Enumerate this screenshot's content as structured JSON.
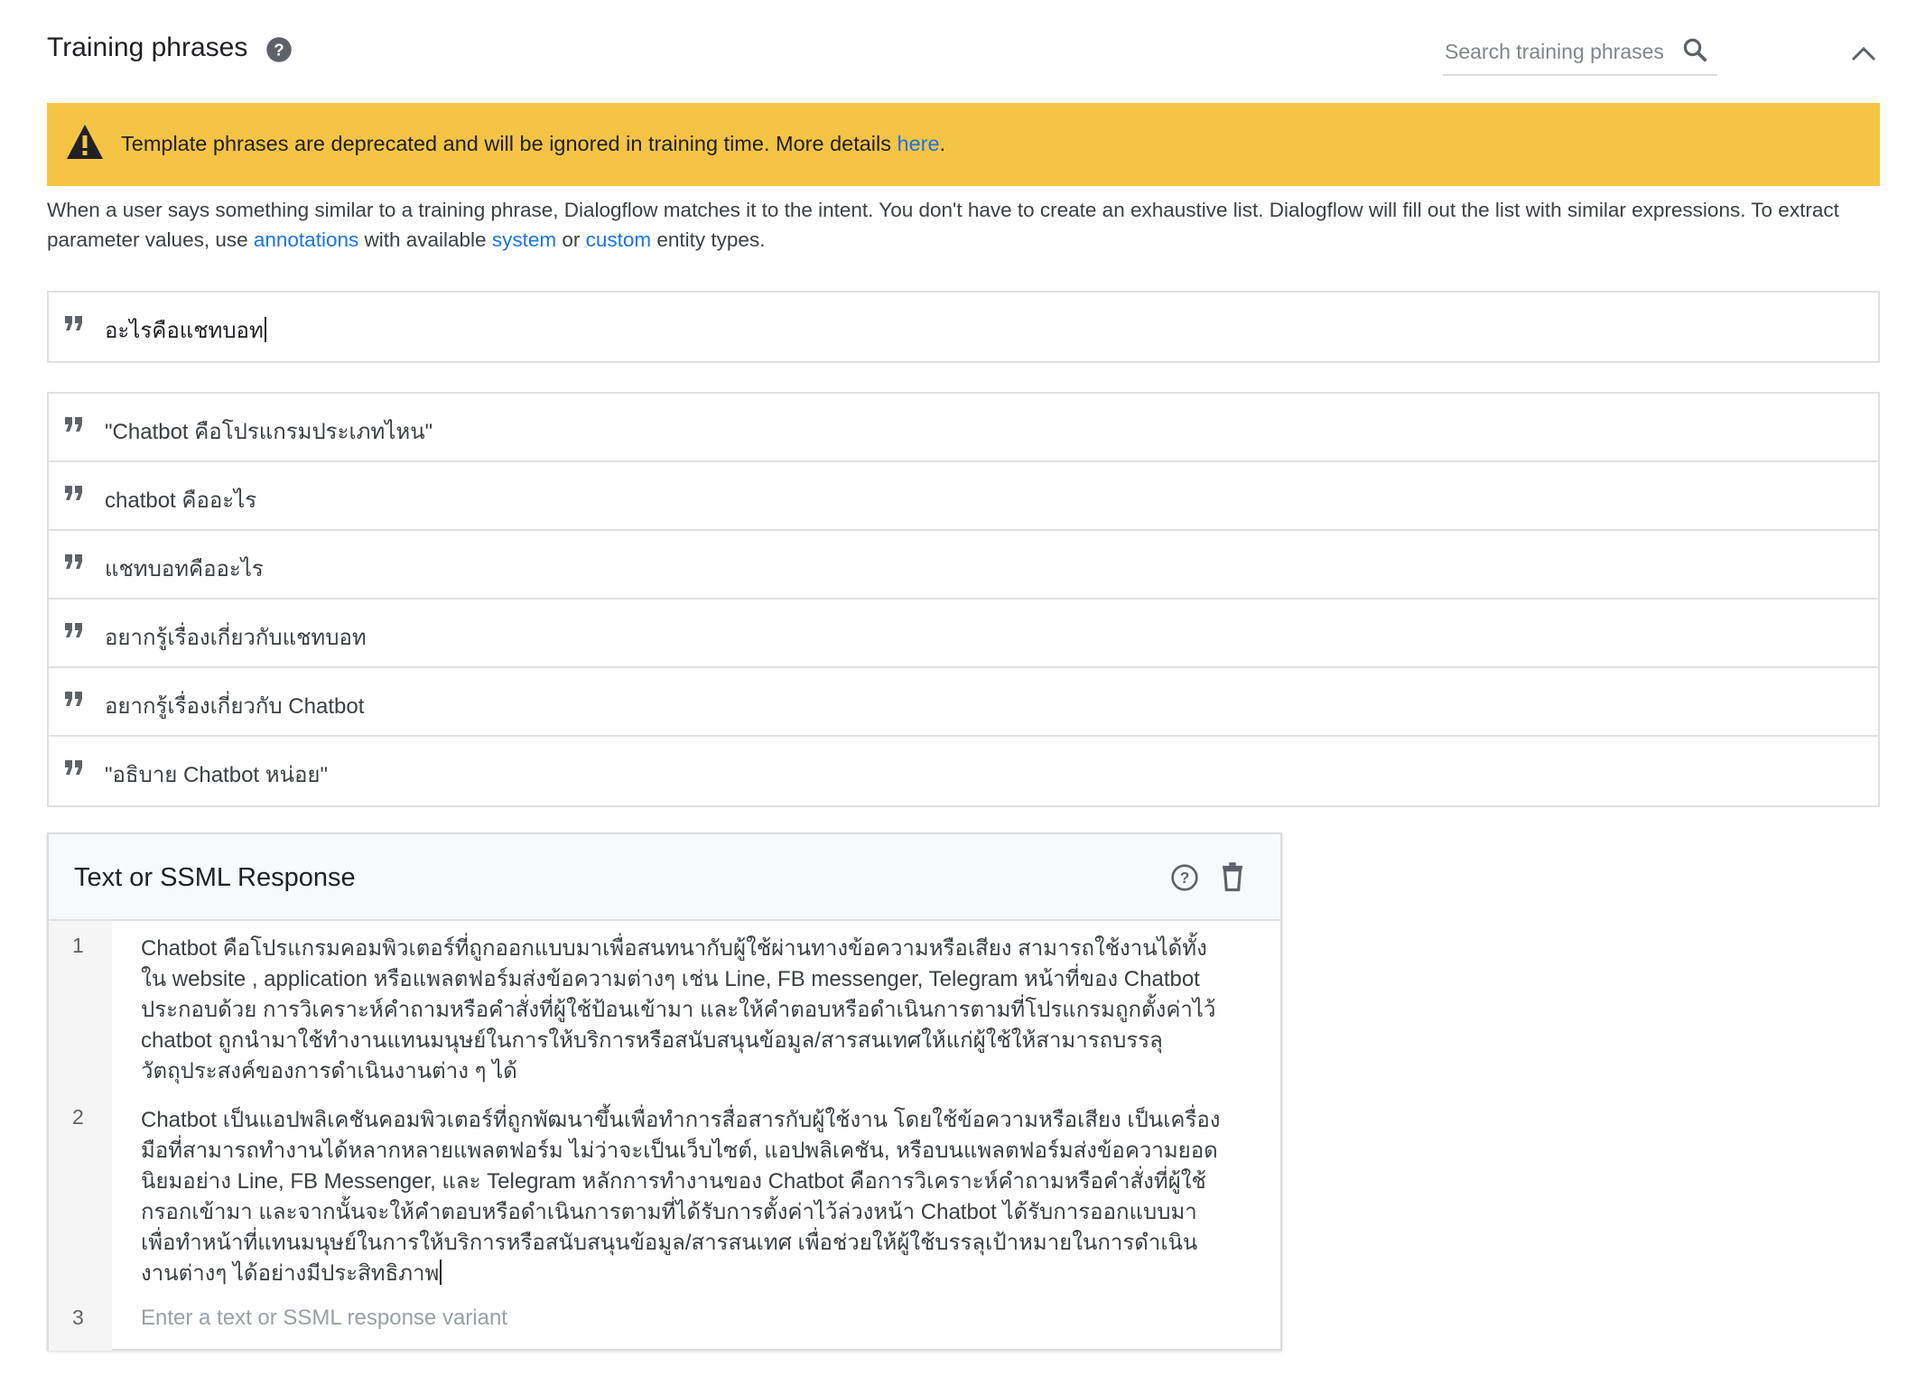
{
  "section": {
    "title": "Training phrases",
    "search_placeholder": "Search training phrases"
  },
  "warning": {
    "text": "Template phrases are deprecated and will be ignored in training time. More details ",
    "link": "here",
    "suffix": "."
  },
  "description": {
    "part1": "When a user says something similar to a training phrase, Dialogflow matches it to the intent. You don't have to create an exhaustive list. Dialogflow will fill out the list with similar expressions. To extract parameter values, use ",
    "link_annotations": "annotations",
    "part2": " with available ",
    "link_system": "system",
    "part3": " or ",
    "link_custom": "custom",
    "part4": " entity types."
  },
  "new_phrase": {
    "value": "อะไรคือแชทบอท"
  },
  "phrases": [
    "\"Chatbot คือโปรแกรมประเภทไหน\"",
    "chatbot คืออะไร",
    "แชทบอทคืออะไร",
    "อยากรู้เรื่องเกี่ยวกับแชทบอท",
    "อยากรู้เรื่องเกี่ยวกับ Chatbot",
    "\"อธิบาย Chatbot หน่อย\""
  ],
  "response": {
    "title": "Text or SSML Response",
    "variants": [
      {
        "num": "1",
        "text": "Chatbot คือโปรแกรมคอมพิวเตอร์ที่ถูกออกแบบมาเพื่อสนทนากับผู้ใช้ผ่านทางข้อความหรือเสียง สามารถใช้งานได้ทั้ง\nใน website , application หรือแพลตฟอร์มส่งข้อความต่างๆ เช่น Line, FB messenger, Telegram หน้าที่ของ Chatbot\nประกอบด้วย การวิเคราะห์คำถามหรือคำสั่งที่ผู้ใช้ป้อนเข้ามา และให้คำตอบหรือดำเนินการตามที่โปรแกรมถูกตั้งค่าไว้\nchatbot ถูกนำมาใช้ทำงานแทนมนุษย์ในการให้บริการหรือสนับสนุนข้อมูล/สารสนเทศให้แก่ผู้ใช้ให้สามารถบรรลุ\nวัตถุประสงค์ของการดำเนินงานต่าง ๆ ได้"
      },
      {
        "num": "2",
        "text": "Chatbot เป็นแอปพลิเคชันคอมพิวเตอร์ที่ถูกพัฒนาขึ้นเพื่อทำการสื่อสารกับผู้ใช้งาน โดยใช้ข้อความหรือเสียง เป็นเครื่อง\nมือที่สามารถทำงานได้หลากหลายแพลตฟอร์ม ไม่ว่าจะเป็นเว็บไซต์, แอปพลิเคชัน, หรือบนแพลตฟอร์มส่งข้อความยอด\nนิยมอย่าง Line, FB Messenger, และ Telegram หลักการทำงานของ Chatbot คือการวิเคราะห์คำถามหรือคำสั่งที่ผู้ใช้\nกรอกเข้ามา และจากนั้นจะให้คำตอบหรือดำเนินการตามที่ได้รับการตั้งค่าไว้ล่วงหน้า Chatbot ได้รับการออกแบบมา\nเพื่อทำหน้าที่แทนมนุษย์ในการให้บริการหรือสนับสนุนข้อมูล/สารสนเทศ เพื่อช่วยให้ผู้ใช้บรรลุเป้าหมายในการดำเนิน\nงานต่างๆ ได้อย่างมีประสิทธิภาพ"
      }
    ],
    "new_variant_num": "3",
    "new_variant_placeholder": "Enter a text or SSML response variant"
  },
  "colors": {
    "warning_bg": "#f6c445",
    "link": "#1a73e8"
  },
  "icons": [
    "help-icon",
    "search-icon",
    "chevron-up-icon",
    "warning-icon",
    "quote-icon",
    "delete-icon"
  ]
}
